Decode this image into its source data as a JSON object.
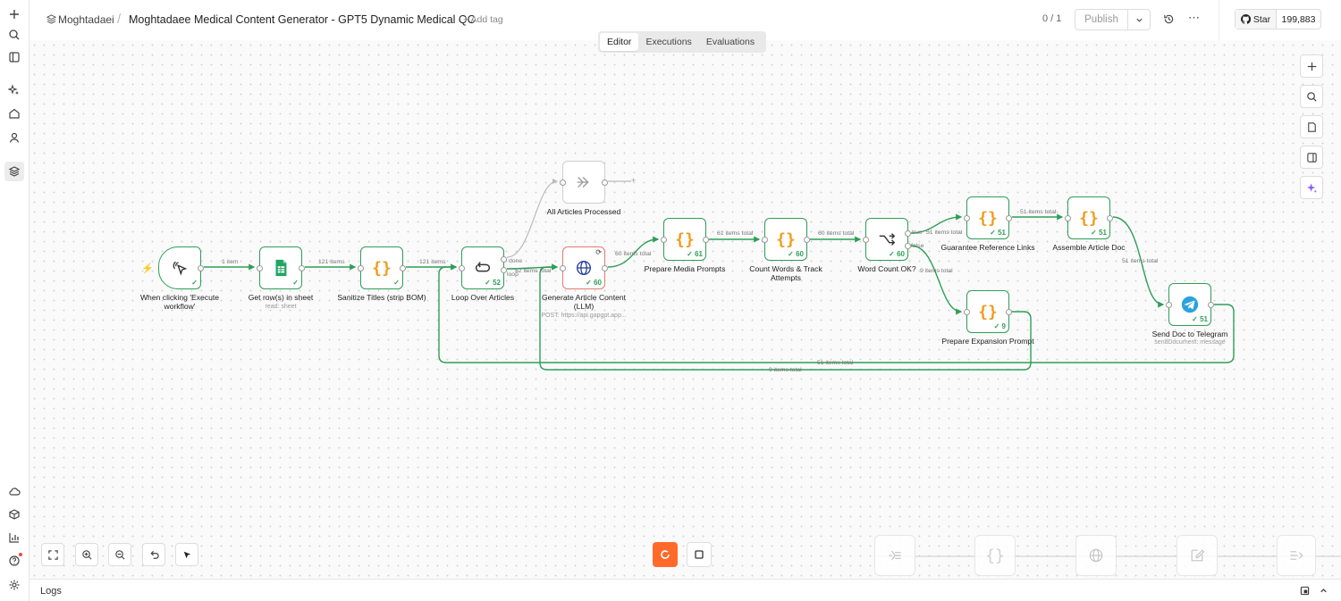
{
  "header": {
    "project": "Moghtadaei",
    "separator": "/",
    "workflow_title": "Moghtadaee Medical Content Generator - GPT5 Dynamic Medical QC",
    "add_tag": "+ Add tag",
    "counter": "0 / 1",
    "publish": "Publish",
    "github_star": "Star",
    "github_count": "199,883"
  },
  "tabs": [
    {
      "label": "Editor",
      "active": true
    },
    {
      "label": "Executions",
      "active": false
    },
    {
      "label": "Evaluations",
      "active": false
    }
  ],
  "nodes": {
    "trigger": {
      "label": "When clicking 'Execute workflow'",
      "icon": "cursor-click-icon"
    },
    "get_rows": {
      "label": "Get row(s) in sheet",
      "sub": "read: sheet",
      "icon": "google-sheets-icon"
    },
    "sanitize": {
      "label": "Sanitize Titles (strip BOM)",
      "icon": "code-braces-icon"
    },
    "loop": {
      "label": "Loop Over Articles",
      "badge": "52",
      "icon": "loop-icon"
    },
    "all_processed": {
      "label": "All Articles Processed",
      "icon": "double-arrow-icon"
    },
    "generate": {
      "label": "Generate Article Content (LLM)",
      "sub": "POST: https://api.gapgpt.app...",
      "badge": "60",
      "icon": "globe-icon"
    },
    "media": {
      "label": "Prepare Media Prompts",
      "badge": "61",
      "icon": "code-braces-icon"
    },
    "count": {
      "label": "Count Words & Track Attempts",
      "badge": "60",
      "icon": "code-braces-icon"
    },
    "word_ok": {
      "label": "Word Count OK?",
      "badge": "60",
      "icon": "if-branch-icon"
    },
    "guarantee": {
      "label": "Guarantee Reference Links",
      "badge": "51",
      "icon": "code-braces-icon"
    },
    "assemble": {
      "label": "Assemble Article Doc",
      "badge": "51",
      "icon": "code-braces-icon"
    },
    "expansion": {
      "label": "Prepare Expansion Prompt",
      "badge": "9",
      "icon": "code-braces-icon"
    },
    "telegram": {
      "label": "Send Doc to Telegram",
      "sub": "sendDocument: message",
      "badge": "51",
      "icon": "telegram-icon"
    }
  },
  "edge_labels": {
    "e1": "1 item",
    "e2": "121 items",
    "e3": "121 items",
    "done": "done",
    "loop": "loop",
    "e_loop_gen": "52 items total",
    "e_gen_media": "60 items total",
    "e_media_count": "61 items total",
    "e_count_if": "60 items total",
    "true_branch": "true",
    "true_items": "51 items total",
    "false_branch": "false",
    "false_items": "9 items total",
    "e_guar_asm": "51 items total",
    "e_asm_tg": "51 items total",
    "back_tg": "51 items total",
    "back_exp": "9 items total"
  },
  "branch_marker": "+",
  "checkmark": "✓",
  "logs": {
    "label": "Logs"
  },
  "colors": {
    "success": "#2e9e57",
    "accent": "#ff6a2b",
    "code": "#f29b1d"
  }
}
